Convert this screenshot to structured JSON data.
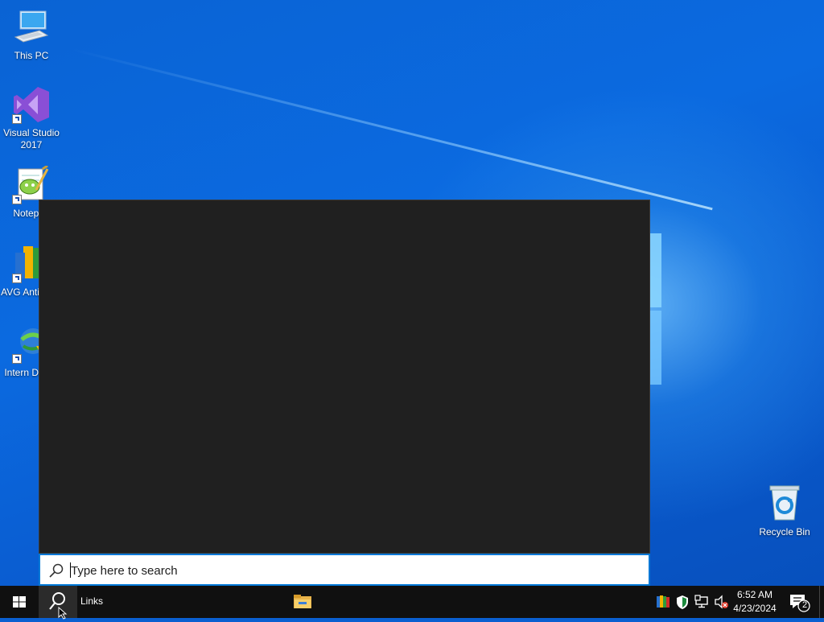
{
  "desktop": {
    "icons": [
      {
        "name": "This PC"
      },
      {
        "name": "Visual Studio 2017"
      },
      {
        "name": "Notepad"
      },
      {
        "name": "AVG Anti Free"
      },
      {
        "name": "Intern Downl"
      },
      {
        "name": "Recycle Bin"
      }
    ]
  },
  "search": {
    "placeholder": "Type here to search",
    "icon": "search-icon"
  },
  "taskbar": {
    "start_icon": "windows-logo-icon",
    "search_icon": "search-icon",
    "links_label": "Links",
    "pinned": [
      {
        "icon": "file-explorer-icon"
      }
    ],
    "tray": {
      "icons": [
        "avg-tray-icon",
        "security-shield-icon",
        "network-icon",
        "volume-muted-icon"
      ],
      "time": "6:52 AM",
      "date": "4/23/2024",
      "notification_count": "2"
    }
  },
  "colors": {
    "accent": "#0078d7",
    "taskbar": "#101010",
    "search_panel": "#202020"
  }
}
